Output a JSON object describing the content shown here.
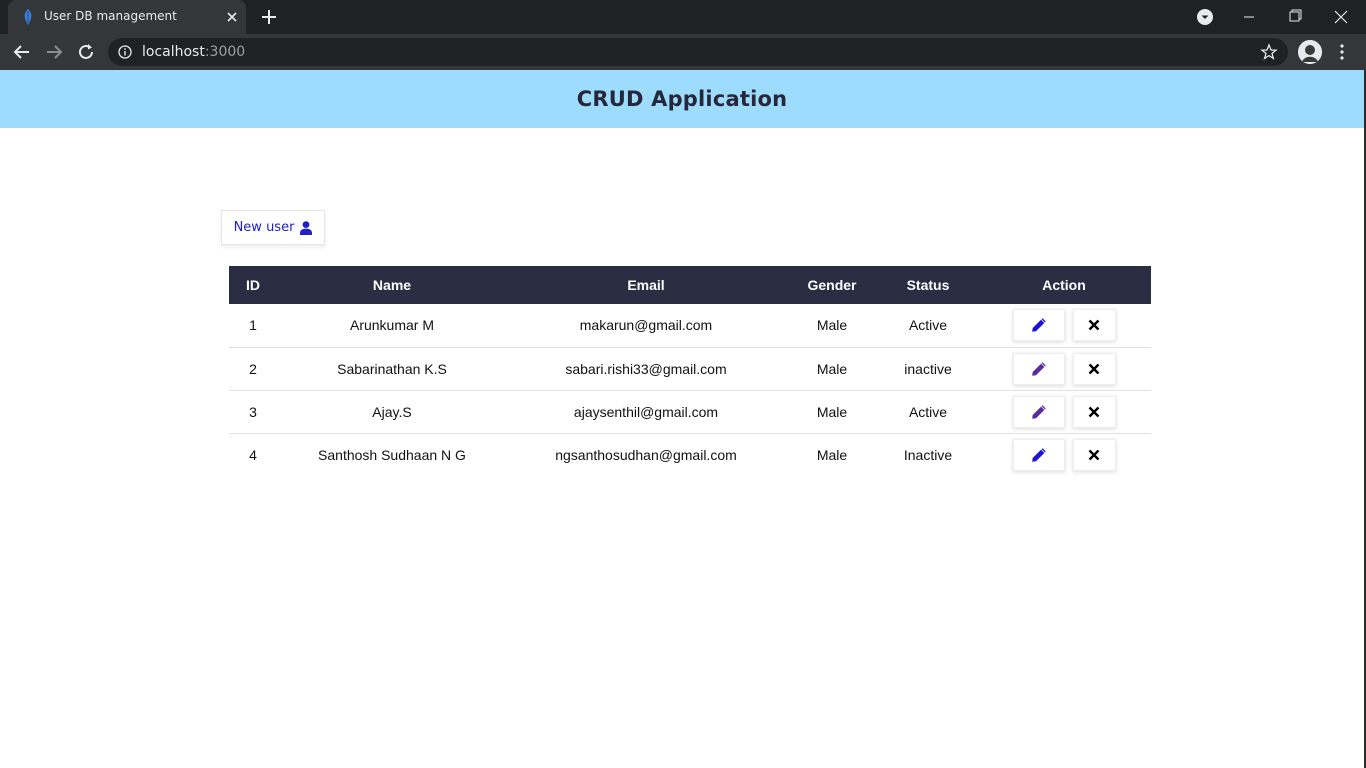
{
  "browser": {
    "tab_title": "User DB management",
    "url_host": "localhost",
    "url_port": ":3000"
  },
  "app": {
    "title": "CRUD Application",
    "new_user_label": "New user"
  },
  "table": {
    "headers": [
      "ID",
      "Name",
      "Email",
      "Gender",
      "Status",
      "Action"
    ],
    "rows": [
      {
        "id": "1",
        "name": "Arunkumar M",
        "email": "makarun@gmail.com",
        "gender": "Male",
        "status": "Active"
      },
      {
        "id": "2",
        "name": "Sabarinathan K.S",
        "email": "sabari.rishi33@gmail.com",
        "gender": "Male",
        "status": "inactive"
      },
      {
        "id": "3",
        "name": "Ajay.S",
        "email": "ajaysenthil@gmail.com",
        "gender": "Male",
        "status": "Active"
      },
      {
        "id": "4",
        "name": "Santhosh Sudhaan N G",
        "email": "ngsanthosudhan@gmail.com",
        "gender": "Male",
        "status": "Inactive"
      }
    ]
  },
  "colors": {
    "header_bg": "#9ddcfd",
    "table_head_bg": "#2b2d42",
    "accent_blue": "#2020c8",
    "edit_icon_active": "#1a13d6",
    "edit_icon_inactive": "#5b2a9e"
  },
  "icons": {
    "edit": "pencil-icon",
    "delete": "close-x-icon",
    "new_user": "user-icon"
  }
}
